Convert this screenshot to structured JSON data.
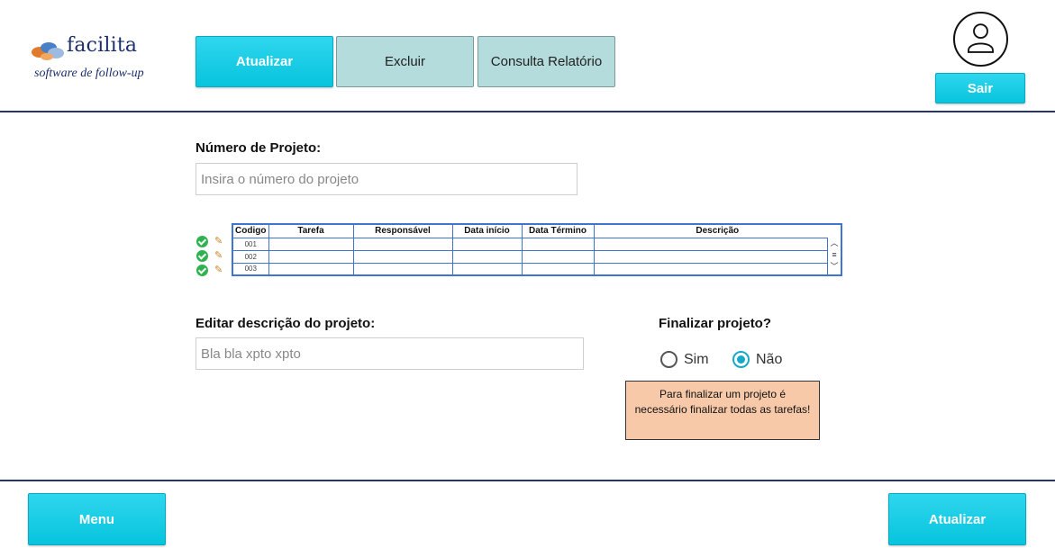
{
  "brand": {
    "name": "facilita",
    "tagline": "software de follow-up"
  },
  "header": {
    "buttons": {
      "atualizar": "Atualizar",
      "excluir": "Excluir",
      "consulta": "Consulta Relatório"
    },
    "sair_label": "Sair"
  },
  "form": {
    "project_number_label": "Número de Projeto:",
    "project_number_placeholder": "Insira o número do projeto",
    "description_label": "Editar descrição do projeto:",
    "description_placeholder": "Bla bla xpto xpto",
    "finalize_label": "Finalizar projeto?",
    "radio_sim": "Sim",
    "radio_nao": "Não",
    "selected": "Não",
    "notice": "Para finalizar um projeto é necessário finalizar todas as tarefas!"
  },
  "table": {
    "columns": [
      "Codigo",
      "Tarefa",
      "Responsável",
      "Data início",
      "Data Término",
      "Descrição"
    ],
    "rows": [
      {
        "codigo": "001",
        "tarefa": "",
        "responsavel": "",
        "data_inicio": "",
        "data_termino": "",
        "descricao": ""
      },
      {
        "codigo": "002",
        "tarefa": "",
        "responsavel": "",
        "data_inicio": "",
        "data_termino": "",
        "descricao": ""
      },
      {
        "codigo": "003",
        "tarefa": "",
        "responsavel": "",
        "data_inicio": "",
        "data_termino": "",
        "descricao": ""
      }
    ]
  },
  "footer": {
    "menu_label": "Menu",
    "atualizar_label": "Atualizar"
  },
  "colors": {
    "accent": "#07c4dd",
    "secondary_button": "#b5dcdc",
    "rule": "#26366b",
    "notice_bg": "#f7c9a8",
    "table_border": "#3f74d1"
  },
  "icons": [
    "logo-mark-icon",
    "user-avatar-icon",
    "check-icon",
    "pencil-icon",
    "scroll-up-icon",
    "scroll-down-icon"
  ]
}
